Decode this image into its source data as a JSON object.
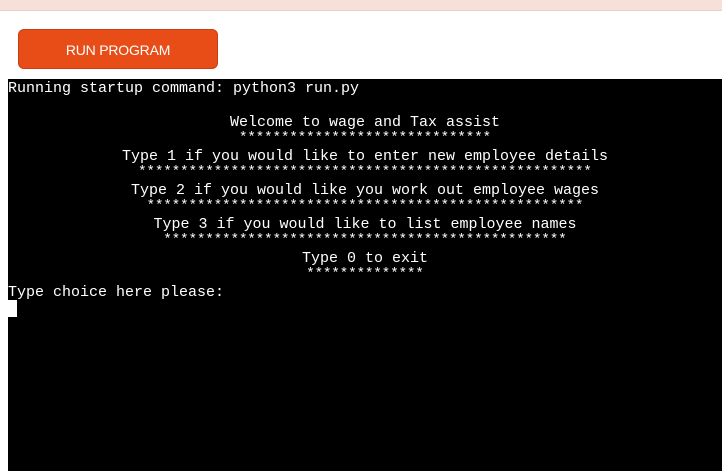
{
  "toolbar": {
    "run_label": "RUN PROGRAM",
    "run_color": "#e84c17"
  },
  "terminal": {
    "startup": "Running startup command: python3 run.py",
    "menu": [
      {
        "text": "Welcome to wage and Tax assist",
        "stars": "******************************"
      },
      {
        "text": "Type 1 if you would like to enter new employee details",
        "stars": "******************************************************"
      },
      {
        "text": "Type 2 if you would like you work out employee wages",
        "stars": "****************************************************"
      },
      {
        "text": "Type 3 if you would like to list employee names",
        "stars": "************************************************"
      },
      {
        "text": "Type 0 to exit",
        "stars": "**************"
      }
    ],
    "prompt": "Type choice here please:",
    "background": "#000000",
    "foreground": "#ffffff"
  }
}
